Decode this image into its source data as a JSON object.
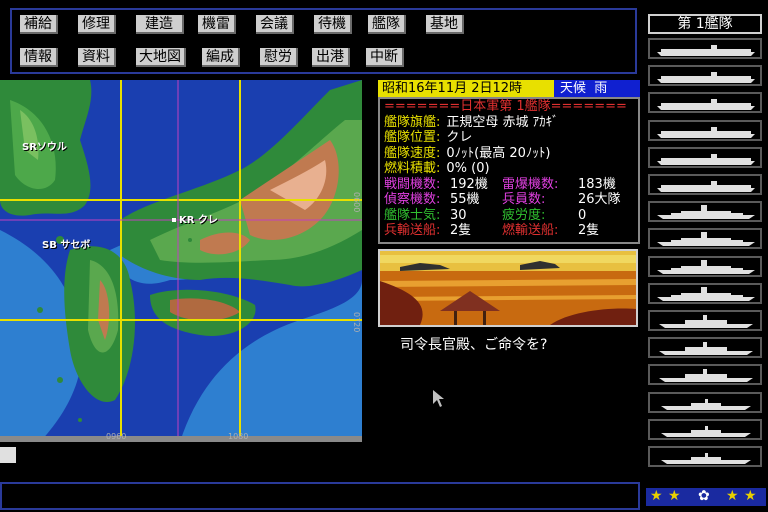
{
  "menu": {
    "row1": [
      "補給",
      "修理",
      "建造",
      "機雷",
      "会議",
      "待機",
      "艦隊",
      "基地"
    ],
    "row2": [
      "情報",
      "資料",
      "大地図",
      "編成",
      "慰労",
      "出港",
      "中断"
    ]
  },
  "map": {
    "cities": [
      {
        "code": "SR",
        "name": "ソウル"
      },
      {
        "code": "KR",
        "name": "クレ"
      },
      {
        "code": "SB",
        "name": "サセボ"
      }
    ],
    "ticks": {
      "x1": "0960",
      "x2": "1080",
      "y1": "0600",
      "y2": "0720"
    }
  },
  "status": {
    "date": "昭和16年11月 2日12時",
    "weather_label": "天候",
    "weather": "雨"
  },
  "fleet": {
    "header": "=======日本軍第 1艦隊=======",
    "rows": [
      {
        "label": "艦隊旗艦:",
        "value": "正規空母 赤城 ｱｶｷﾞ"
      },
      {
        "label": "艦隊位置:",
        "value": "クレ"
      },
      {
        "label": "艦隊速度:",
        "value": "0ﾉｯﾄ(最高 20ﾉｯﾄ)"
      },
      {
        "label": "燃料積載:",
        "value": "0% (0)"
      }
    ],
    "stats": [
      {
        "l1": "戦闘機数:",
        "v1": "192機",
        "l2": "雷爆機数:",
        "v2": "183機"
      },
      {
        "l1": "偵察機数:",
        "v1": "55機",
        "l2": "兵員数:",
        "v2": "26大隊"
      },
      {
        "l1": "艦隊士気:",
        "v1": "30",
        "l2": "疲労度:",
        "v2": "0"
      },
      {
        "l1": "兵輸送船:",
        "v1": "2隻",
        "l2": "燃輸送船:",
        "v2": "2隻"
      }
    ]
  },
  "message": "司令長官殿、ご命令を?",
  "fleet_panel": {
    "title": "第 1艦隊",
    "ships": [
      "carrier",
      "carrier",
      "carrier",
      "carrier",
      "carrier",
      "carrier",
      "battleship",
      "battleship",
      "battleship",
      "battleship",
      "cruiser",
      "cruiser",
      "cruiser",
      "destroyer",
      "destroyer",
      "destroyer"
    ]
  },
  "colors": {
    "menu_bg": "#cfcfcf",
    "date_bg": "#e8e000",
    "weather_bg": "#1020d0",
    "panel_blue": "#2a3a9a",
    "sea": "#1a3fb0"
  }
}
